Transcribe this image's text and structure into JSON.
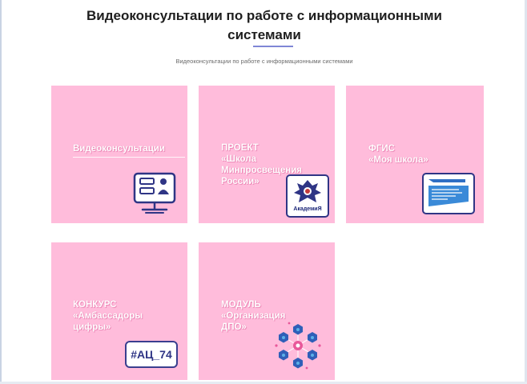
{
  "page": {
    "title": "Видеоконсультации по работе с информационными системами",
    "subtitle": "Видеоконсультации по работе с информационными системами"
  },
  "tiles": [
    {
      "label": "Видеоконсультации",
      "icon": "video-consultation-icon"
    },
    {
      "label": "ПРОЕКТ\n«Школа\nМинпросвещения\nРоссии»",
      "icon": "academy-logo-icon",
      "badge": "АкадемиЯ"
    },
    {
      "label": "ФГИС\n«Моя школа»",
      "icon": "my-school-logo-icon"
    },
    {
      "label": "КОНКУРС\n«Амбассадоры\nцифры»",
      "icon": "hashtag-badge",
      "badge": "#АЦ_74"
    },
    {
      "label": "МОДУЛЬ\n«Организация\nДПО»",
      "icon": "network-hexagons-icon"
    }
  ],
  "colors": {
    "tile_bg": "#ffbcdb",
    "accent": "#7f86d6",
    "icon_navy": "#2f3585"
  }
}
